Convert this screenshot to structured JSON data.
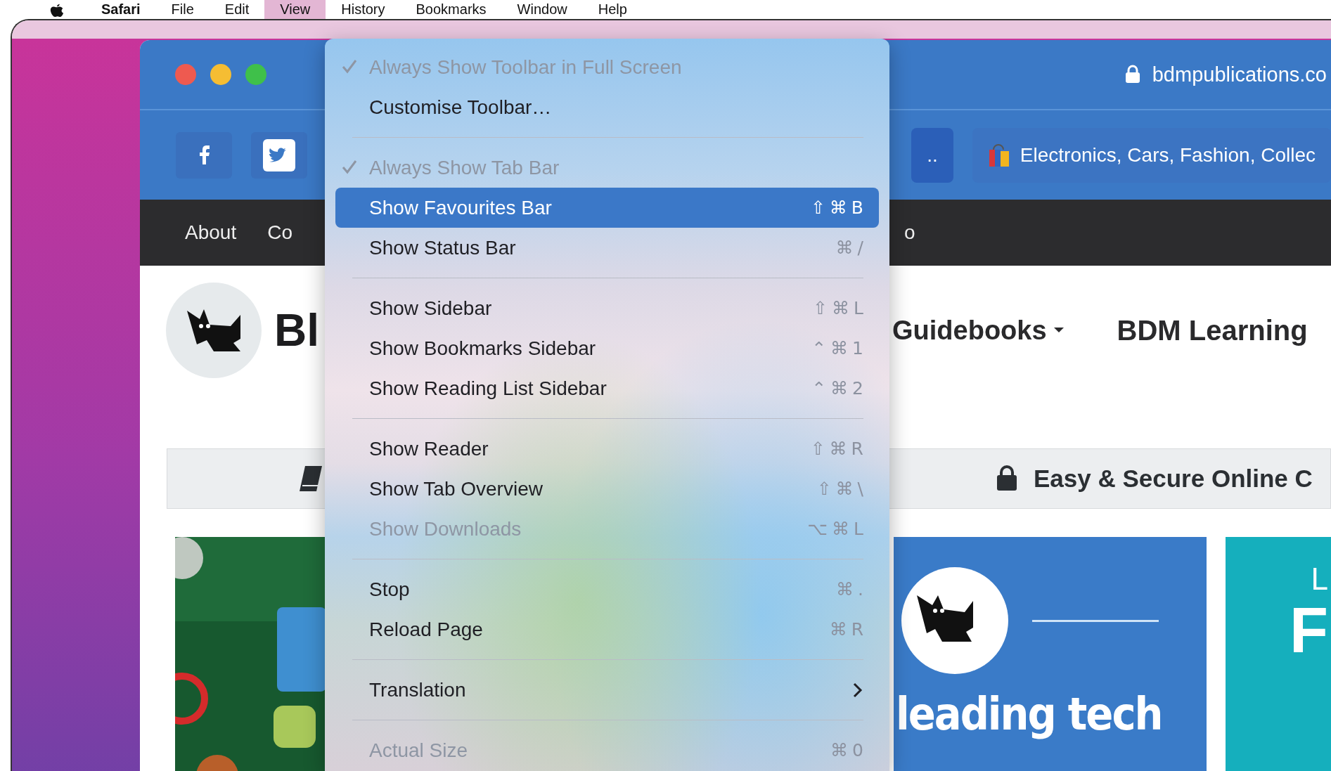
{
  "menubar": {
    "items": [
      {
        "label": "Safari",
        "selected": false
      },
      {
        "label": "File",
        "selected": false
      },
      {
        "label": "Edit",
        "selected": false
      },
      {
        "label": "View",
        "selected": true
      },
      {
        "label": "History",
        "selected": false
      },
      {
        "label": "Bookmarks",
        "selected": false
      },
      {
        "label": "Window",
        "selected": false
      },
      {
        "label": "Help",
        "selected": false
      }
    ]
  },
  "browser": {
    "address": "bdmpublications.co",
    "tabs": [
      {
        "label": "..",
        "selected": true
      },
      {
        "label": "Electronics, Cars, Fashion, Collec",
        "selected": false
      }
    ],
    "nav_links": [
      "About",
      "Co",
      "o"
    ],
    "site": {
      "title": "Bl",
      "menu": [
        {
          "label": "Guidebooks",
          "dropdown": true
        },
        {
          "label": "BDM Learning",
          "dropdown": false
        }
      ]
    },
    "notice": "Easy & Secure Online C",
    "cards": [
      {
        "kind": "picture"
      },
      {
        "kind": "brand",
        "headline": "leading tech"
      },
      {
        "kind": "promo",
        "letters": [
          "L",
          "F"
        ]
      }
    ]
  },
  "view_menu": {
    "items": [
      {
        "kind": "item",
        "label": "Always Show Toolbar in Full Screen",
        "checked": true,
        "disabled": true,
        "selected": false
      },
      {
        "kind": "item",
        "label": "Customise Toolbar…",
        "checked": false,
        "disabled": false,
        "selected": false
      },
      {
        "kind": "separator"
      },
      {
        "kind": "item",
        "label": "Always Show Tab Bar",
        "checked": true,
        "disabled": true,
        "selected": false
      },
      {
        "kind": "item",
        "label": "Show Favourites Bar",
        "shortcut": "⇧⌘B",
        "checked": false,
        "disabled": false,
        "selected": true
      },
      {
        "kind": "item",
        "label": "Show Status Bar",
        "shortcut": "⌘/",
        "checked": false,
        "disabled": false,
        "selected": false
      },
      {
        "kind": "separator"
      },
      {
        "kind": "item",
        "label": "Show Sidebar",
        "shortcut": "⇧⌘L",
        "checked": false,
        "disabled": false,
        "selected": false
      },
      {
        "kind": "item",
        "label": "Show Bookmarks Sidebar",
        "shortcut": "⌃⌘1",
        "checked": false,
        "disabled": false,
        "selected": false
      },
      {
        "kind": "item",
        "label": "Show Reading List Sidebar",
        "shortcut": "⌃⌘2",
        "checked": false,
        "disabled": false,
        "selected": false
      },
      {
        "kind": "separator"
      },
      {
        "kind": "item",
        "label": "Show Reader",
        "shortcut": "⇧⌘R",
        "checked": false,
        "disabled": false,
        "selected": false
      },
      {
        "kind": "item",
        "label": "Show Tab Overview",
        "shortcut": "⇧⌘\\",
        "checked": false,
        "disabled": false,
        "selected": false
      },
      {
        "kind": "item",
        "label": "Show Downloads",
        "shortcut": "⌥⌘L",
        "checked": false,
        "disabled": true,
        "selected": false
      },
      {
        "kind": "separator"
      },
      {
        "kind": "item",
        "label": "Stop",
        "shortcut": "⌘.",
        "checked": false,
        "disabled": false,
        "selected": false
      },
      {
        "kind": "item",
        "label": "Reload Page",
        "shortcut": "⌘R",
        "checked": false,
        "disabled": false,
        "selected": false
      },
      {
        "kind": "separator"
      },
      {
        "kind": "submenu",
        "label": "Translation",
        "checked": false,
        "disabled": false,
        "selected": false
      },
      {
        "kind": "separator"
      },
      {
        "kind": "item",
        "label": "Actual Size",
        "shortcut": "⌘0",
        "checked": false,
        "disabled": true,
        "selected": false
      }
    ]
  }
}
